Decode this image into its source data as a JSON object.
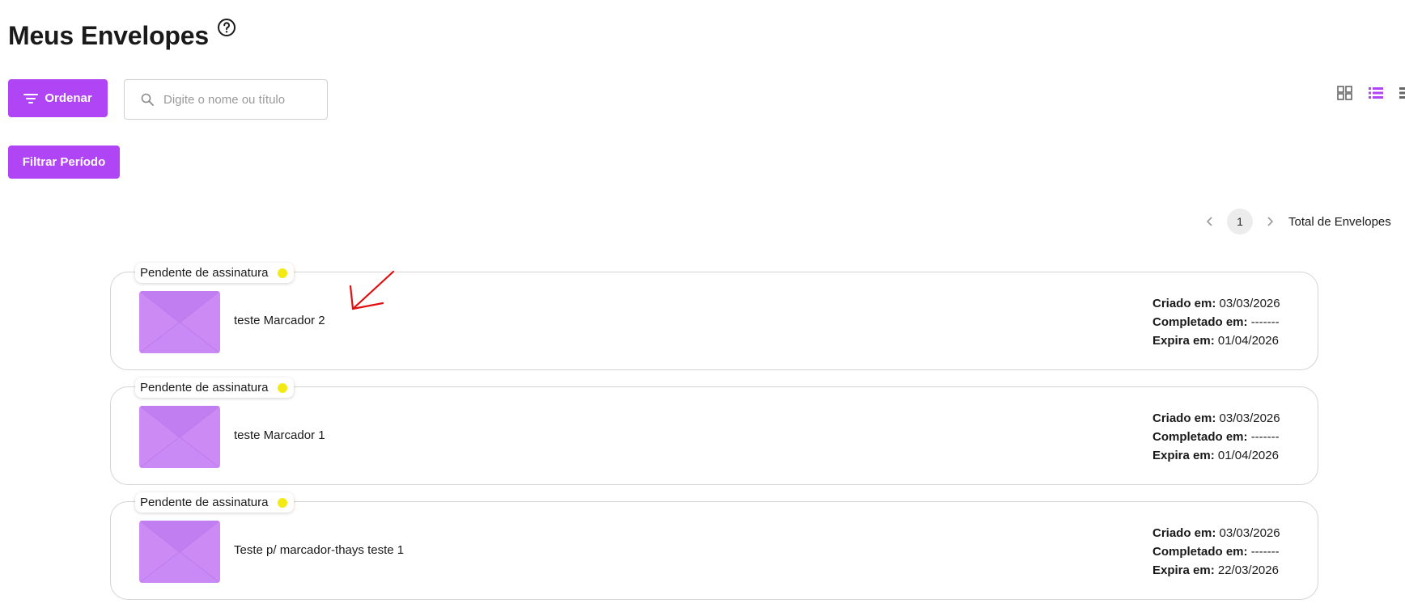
{
  "header": {
    "title": "Meus Envelopes",
    "help_icon": "help-circle-icon"
  },
  "toolbar": {
    "order_label": "Ordenar",
    "order_icon": "filter-lines-icon",
    "search_placeholder": "Digite o nome ou título",
    "search_icon": "search-icon",
    "period_label": "Filtrar Período",
    "views": [
      "grid-view-icon",
      "list-view-icon",
      "compact-list-view-icon"
    ]
  },
  "pagination": {
    "current_page": "1",
    "total_label": "Total de Envelopes"
  },
  "colors": {
    "accent": "#b045f5",
    "status_pending": "#f3ea14",
    "thumb": "#cc8af5",
    "annotation": "#e01010"
  },
  "envelopes": [
    {
      "status": "Pendente de assinatura",
      "title": "teste Marcador 2",
      "created_label": "Criado em:",
      "created": "03/03/2026",
      "completed_label": "Completado em:",
      "completed": "-------",
      "expires_label": "Expira em:",
      "expires": "01/04/2026"
    },
    {
      "status": "Pendente de assinatura",
      "title": "teste Marcador 1",
      "created_label": "Criado em:",
      "created": "03/03/2026",
      "completed_label": "Completado em:",
      "completed": "-------",
      "expires_label": "Expira em:",
      "expires": "01/04/2026"
    },
    {
      "status": "Pendente de assinatura",
      "title": "Teste p/ marcador-thays teste 1",
      "created_label": "Criado em:",
      "created": "03/03/2026",
      "completed_label": "Completado em:",
      "completed": "-------",
      "expires_label": "Expira em:",
      "expires": "22/03/2026"
    }
  ]
}
